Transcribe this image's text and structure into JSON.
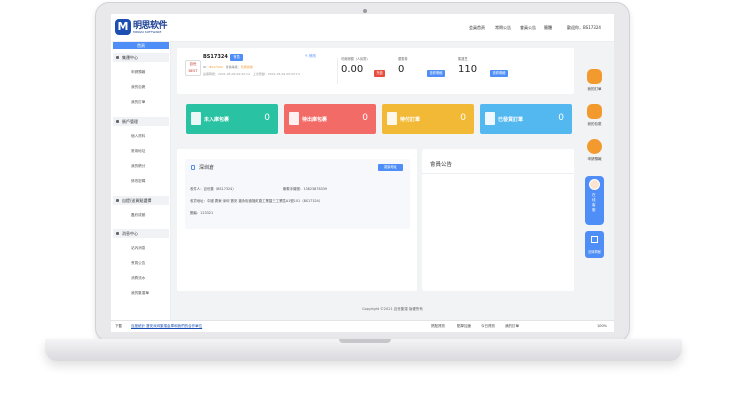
{
  "brand": {
    "name": "明思软件",
    "sub": "MINGSI SOFTWARE"
  },
  "nav": {
    "home": "会員首頁",
    "announce": "常問公告",
    "notice": "會員公告",
    "lang": "簡體",
    "user_prefix": "歡迎你，",
    "user_id": "BS17324"
  },
  "sidebar": {
    "top_button": "首頁",
    "groups": [
      {
        "label": "集運中心",
        "items": [
          "申請預報",
          "我的包裹",
          "我的訂單"
        ]
      },
      {
        "label": "賬戶管理",
        "items": [
          "個人資料",
          "常用地址",
          "我的積分",
          "修改密碼"
        ]
      },
      {
        "label": "自提/送貨點選擇",
        "items": [
          "盡欣成都"
        ]
      },
      {
        "label": "消息中心",
        "items": [
          "站內消息",
          "會員公告",
          "消費流水",
          "我的集運單"
        ]
      }
    ]
  },
  "profile": {
    "id": "BS17324",
    "badge": "會員",
    "avatar_text": "百世",
    "avatar_sub": "BEST",
    "code_label": "ID：",
    "code": "BS17324",
    "level_label": "會員等級：",
    "level": "普通會員",
    "reg_label": "註冊時間：2021-05-09 09:52:14",
    "login_label": "上次登錄：2021-05-09 09:52:14",
    "edit": "修改"
  },
  "stats": [
    {
      "label": "可用餘額（人民幣）",
      "value": "0.00",
      "btn": "充值"
    },
    {
      "label": "優惠券",
      "value": "0",
      "btn": "查看明細"
    },
    {
      "label": "集運豆",
      "value": "110",
      "btn": "查看明細"
    }
  ],
  "tiles": [
    {
      "label": "未入庫包裹",
      "value": "0",
      "color": "#29c2a2"
    },
    {
      "label": "待出庫包裹",
      "value": "0",
      "color": "#f36b67"
    },
    {
      "label": "待付訂單",
      "value": "0",
      "color": "#f1b936"
    },
    {
      "label": "已發貨訂單",
      "value": "0",
      "color": "#52b8ef"
    }
  ],
  "address": {
    "title": "深圳倉",
    "button": "複製地址",
    "lines": [
      "收件人：百世集（BS17324）",
      "聯繫手機號：13823878339",
      "收貨地址：中國 廣東 深圳 寶安 福永街道福虹路工業園三工業區A1號101（BS17324）",
      "郵編：123321"
    ]
  },
  "announce": {
    "title": "會員公告"
  },
  "right_panel": [
    {
      "label": "我的訂單"
    },
    {
      "label": "我的包裹"
    },
    {
      "label": "申請預報"
    },
    {
      "label": "在线客服"
    },
    {
      "label": "石碌揭秘"
    }
  ],
  "footer": "Copyright ©2021 百世集運 版權所有",
  "status": {
    "left": "下載",
    "item1": "百度統計 寶安深圳集運倉庫和我們的合作單位",
    "left2": "熱點資訊",
    "right_items": [
      "點擊加速",
      "今日資訊",
      "我的訂單"
    ],
    "zoom": "100%"
  },
  "colors": {
    "accent": "#4f8ef7",
    "orange": "#f39a2e"
  }
}
